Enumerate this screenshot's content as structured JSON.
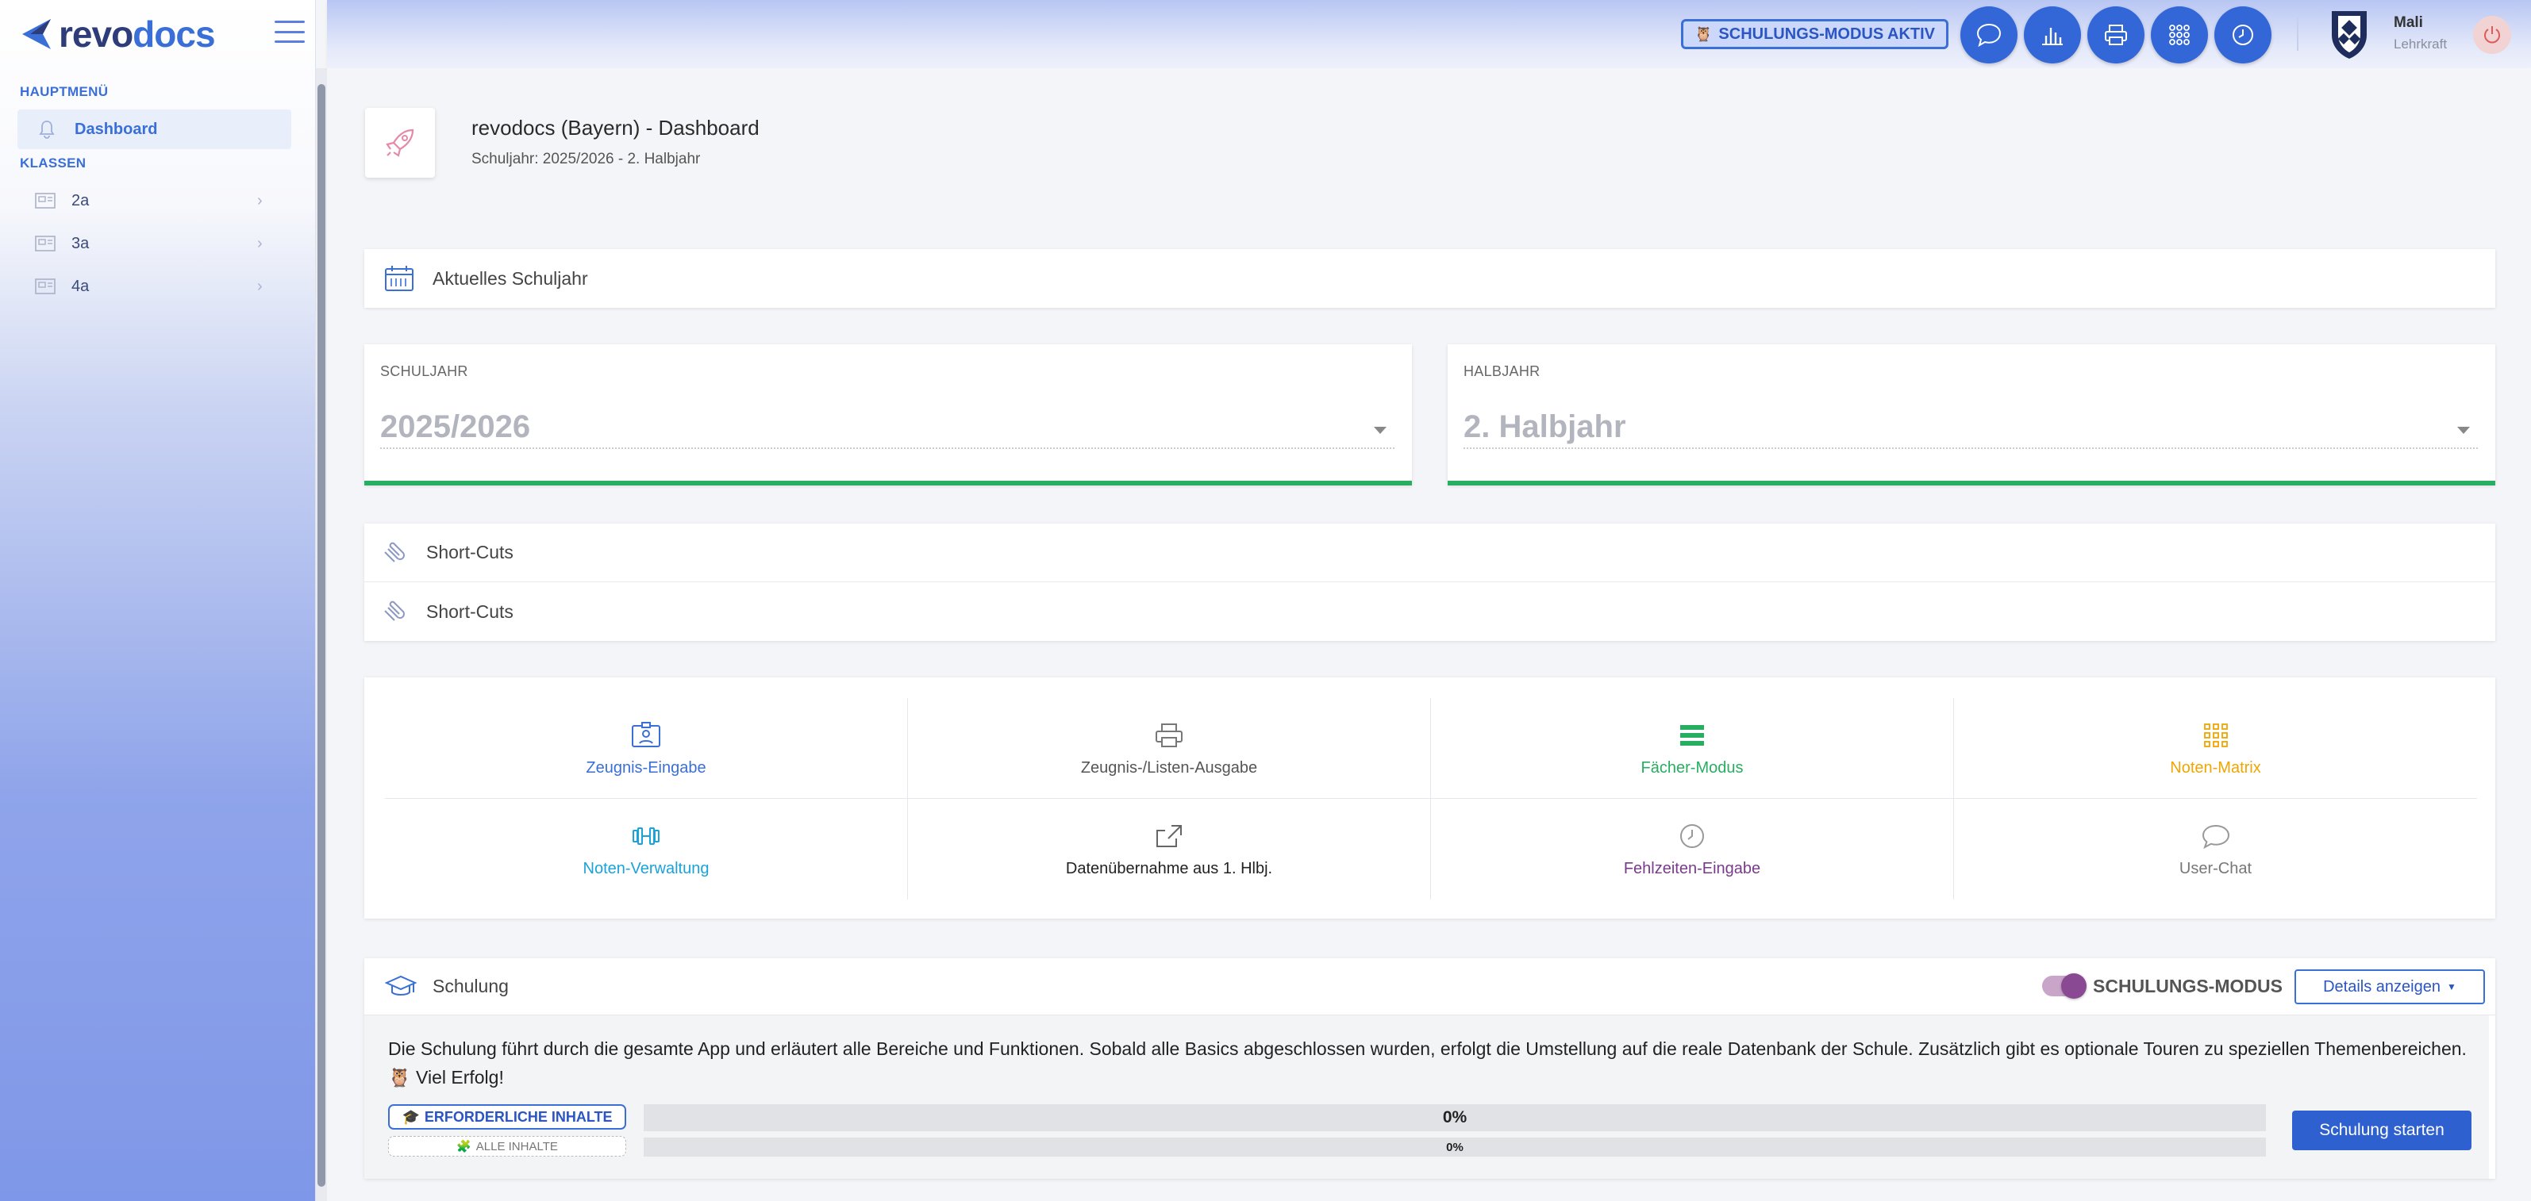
{
  "brand": {
    "logo_rev": "revo",
    "logo_docs": "docs"
  },
  "sidebar": {
    "main_heading": "HAUPTMENÜ",
    "dashboard_label": "Dashboard",
    "classes_heading": "KLASSEN",
    "classes": [
      {
        "label": "2a"
      },
      {
        "label": "3a"
      },
      {
        "label": "4a"
      }
    ]
  },
  "topbar": {
    "mode_badge": "SCHULUNGS-MODUS AKTIV",
    "buttons": [
      "chat-icon",
      "chart-icon",
      "print-icon",
      "apps-grid-icon",
      "clock-icon"
    ],
    "user_name": "Mali",
    "user_role": "Lehrkraft"
  },
  "page": {
    "title": "revodocs (Bayern) - Dashboard",
    "subtitle": "Schuljahr: 2025/2026 - 2. Halbjahr"
  },
  "current_year": {
    "title": "Aktuelles Schuljahr"
  },
  "selectors": {
    "year_label": "SCHULJAHR",
    "year_value": "2025/2026",
    "half_label": "HALBJAHR",
    "half_value": "2. Halbjahr"
  },
  "shortcuts": {
    "row1": "Short-Cuts",
    "row2": "Short-Cuts"
  },
  "tiles": [
    {
      "label": "Zeugnis-Eingabe",
      "icon": "id-card-icon",
      "color": "#3a6fd8"
    },
    {
      "label": "Zeugnis-/Listen-Ausgabe",
      "icon": "print-icon",
      "color": "#555555"
    },
    {
      "label": "Fächer-Modus",
      "icon": "list-rows-icon",
      "color": "#27ae60"
    },
    {
      "label": "Noten-Matrix",
      "icon": "matrix-icon",
      "color": "#f0a500"
    },
    {
      "label": "Noten-Verwaltung",
      "icon": "dumbbell-icon",
      "color": "#1aa3d9"
    },
    {
      "label": "Datenübernahme aus 1. Hlbj.",
      "icon": "share-icon",
      "color": "#222222"
    },
    {
      "label": "Fehlzeiten-Eingabe",
      "icon": "clock-icon",
      "color": "#7a3a8c"
    },
    {
      "label": "User-Chat",
      "icon": "chat-icon",
      "color": "#777777"
    }
  ],
  "training": {
    "title": "Schulung",
    "toggle_label": "SCHULUNGS-MODUS",
    "details_button": "Details anzeigen",
    "description": "Die Schulung führt durch die gesamte App und erläutert alle Bereiche und Funktionen. Sobald alle Basics abgeschlossen wurden, erfolgt die Umstellung auf die reale Datenbank der Schule. Zusätzlich gibt es optionale Touren zu speziellen Themenbereichen.",
    "good_luck": "Viel Erfolg!",
    "required_pill": "ERFORDERLICHE INHALTE",
    "all_pill": "ALLE INHALTE",
    "progress_required": "0%",
    "progress_all": "0%",
    "progress_required_fraction": 0,
    "progress_all_fraction": 0,
    "start_button": "Schulung starten"
  },
  "colors": {
    "accent": "#3366d6",
    "success": "#27ae60",
    "toggle": "#8a4a93"
  }
}
